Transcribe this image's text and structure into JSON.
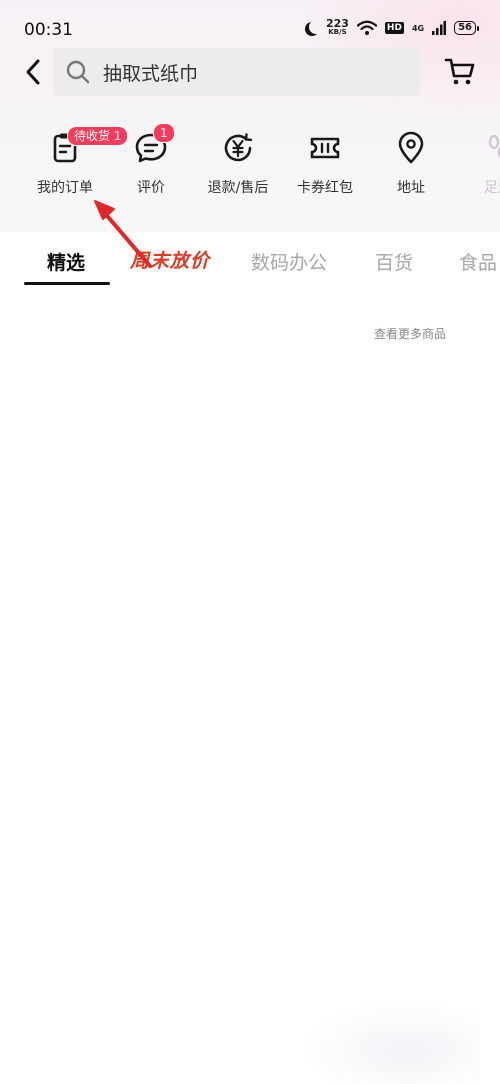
{
  "status_bar": {
    "time": "00:31",
    "speed_value": "223",
    "speed_unit": "KB/S",
    "hd": "HD",
    "network": "4G",
    "battery": "56"
  },
  "search": {
    "query": "抽取式纸巾"
  },
  "quick_entries": [
    {
      "label": "我的订单",
      "badge": "待收货 1",
      "icon": "order-list-icon"
    },
    {
      "label": "评价",
      "badge": "1",
      "icon": "comment-bubble-icon"
    },
    {
      "label": "退款/售后",
      "icon": "yuan-refund-icon"
    },
    {
      "label": "卡券红包",
      "icon": "coupon-ticket-icon"
    },
    {
      "label": "地址",
      "icon": "location-pin-icon"
    },
    {
      "label": "足迹",
      "icon": "footprint-icon"
    }
  ],
  "tabs": [
    {
      "label": "精选",
      "active": true
    },
    {
      "label": "周末放价",
      "promo": true
    },
    {
      "label": "数码办公"
    },
    {
      "label": "百货"
    },
    {
      "label": "食品"
    }
  ],
  "see_more": "查看更多商品",
  "colors": {
    "badge": "#fa3a5a",
    "promo": "#e13a22",
    "annotation_arrow": "#e32626"
  }
}
